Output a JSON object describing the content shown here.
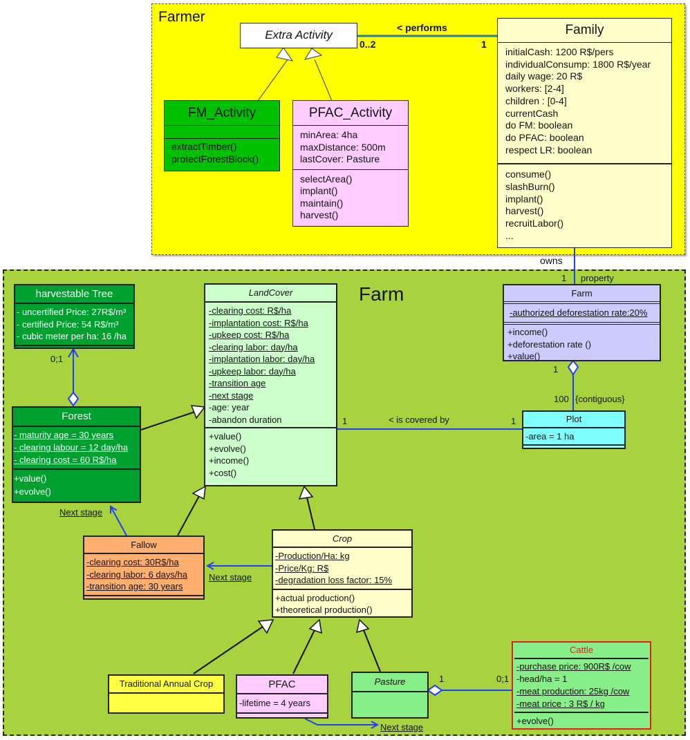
{
  "packages": {
    "farmer": "Farmer",
    "farm": "Farm"
  },
  "classes": {
    "extra_activity": {
      "name": "Extra Activity"
    },
    "family": {
      "name": "Family",
      "attributes": [
        "initialCash: 1200 R$/pers",
        "individualConsump: 1800 R$/year",
        "daily wage: 20 R$",
        "workers: [2-4]",
        "children : [0-4]",
        "currentCash",
        "do FM: boolean",
        "do PFAC: boolean",
        "respect LR: boolean"
      ],
      "operations": [
        "consume()",
        "slashBurn()",
        "implant()",
        "harvest()",
        "recruitLabor()",
        "..."
      ]
    },
    "fm_activity": {
      "name": "FM_Activity",
      "operations": [
        "extractTimber()",
        "protectForestBlock()"
      ]
    },
    "pfac_activity": {
      "name": "PFAC_Activity",
      "attributes": [
        "minArea: 4ha",
        "maxDistance: 500m",
        "lastCover: Pasture"
      ],
      "operations": [
        "selectArea()",
        "implant()",
        "maintain()",
        "harvest()"
      ]
    },
    "harvestable_tree": {
      "name": "harvestable Tree",
      "attributes": [
        "- uncertified Price: 27R$/m³",
        "- certified Price: 54 R$/m³",
        "- cubic meter per ha: 16 /ha"
      ]
    },
    "landcover": {
      "name": "LandCover",
      "static_attributes": [
        "-clearing cost: R$/ha",
        "-implantation cost: R$/ha",
        "-upkeep cost: R$/ha",
        "-clearing labor: day/ha",
        "-implantation labor: day/ha",
        "-upkeep labor: day/ha",
        "-transition age",
        "-next stage"
      ],
      "attributes": [
        "-age: year",
        "-abandon duration"
      ],
      "operations": [
        "+value()",
        "+evolve()",
        "+income()",
        "+cost()"
      ]
    },
    "farm": {
      "name": "Farm",
      "attributes": [
        "-authorized deforestation rate:20%"
      ],
      "operations": [
        "+income()",
        "+deforestation rate ()",
        "+value()"
      ]
    },
    "plot": {
      "name": "Plot",
      "attributes": [
        "-area = 1 ha"
      ]
    },
    "forest": {
      "name": "Forest",
      "attributes": [
        "- maturity age = 30 years",
        "- clearing labour = 12 day/ha",
        "- clearing cost = 60 R$/ha"
      ],
      "operations": [
        "+value()",
        "+evolve()"
      ]
    },
    "fallow": {
      "name": "Fallow",
      "attributes": [
        "-clearing cost: 30R$/ha",
        "-clearing labor: 6 days/ha",
        "-transition age: 30 years"
      ]
    },
    "crop": {
      "name": "Crop",
      "attributes": [
        "-Production/Ha: kg",
        "-Price/Kg: R$",
        "-degradation loss factor: 15%"
      ],
      "operations": [
        "+actual production()",
        "+theoretical production()"
      ]
    },
    "traditional_annual_crop": {
      "name": "Traditional Annual Crop"
    },
    "pfac": {
      "name": "PFAC",
      "attributes": [
        "-lifetime = 4 years"
      ]
    },
    "pasture": {
      "name": "Pasture"
    },
    "cattle": {
      "name": "Cattle",
      "attributes": [
        {
          "text": "-purchase price: 900R$ /cow",
          "static": true
        },
        {
          "text": "-head/ha = 1",
          "static": false
        },
        {
          "text": "-meat production: 25kg /cow",
          "static": true
        },
        {
          "text": "-meat price : 3 R$ / kg ",
          "static": true
        }
      ],
      "operations": [
        "+evolve()"
      ]
    }
  },
  "associations": {
    "performs": {
      "label": "< performs",
      "mult_left": "0..2",
      "mult_right": "1"
    },
    "owns": {
      "label": "owns",
      "mult": "1",
      "role": "property"
    },
    "farm_plot": {
      "mult_top": "1",
      "mult_bottom": "100",
      "constraint": "{contiguous}"
    },
    "covered_by": {
      "label": "< is covered by",
      "mult_left": "1",
      "mult_right": "1"
    },
    "tree_forest": {
      "mult": "0;1"
    },
    "pasture_cattle": {
      "mult_left": "1",
      "mult_right": "0;1"
    },
    "next_stage_forest": "Next stage",
    "next_stage_fallow": "Next stage",
    "next_stage_pasture": "Next stage"
  },
  "colors": {
    "farmer_pkg": "#ffff00",
    "farm_pkg": "#a8d23e",
    "family": "#ffffcc",
    "fm_activity": "#00c000",
    "pfac_activity": "#ffccff",
    "harvestable_tree": "#00a030",
    "forest": "#00a030",
    "landcover": "#ccffcc",
    "farm": "#ccccff",
    "plot": "#80ffff",
    "fallow": "#ffb070",
    "crop": "#ffffcc",
    "traditional_annual_crop": "#ffff44",
    "pfac": "#ffccff",
    "pasture": "#88ee88",
    "cattle": "#88ee88",
    "cattle_border": "#e02020",
    "association_line": "#1f3fff"
  }
}
